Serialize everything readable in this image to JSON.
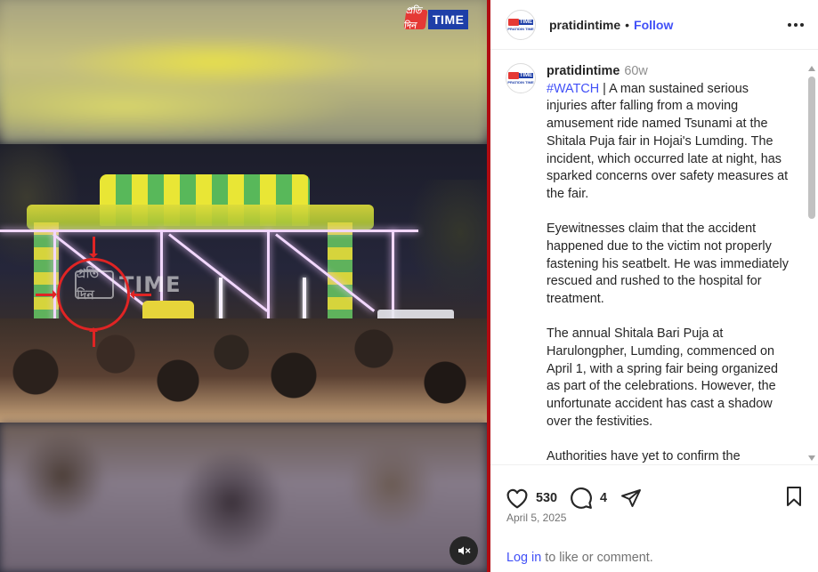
{
  "media": {
    "brand_badge": "প্রতি দিন",
    "brand_time": "TIME",
    "watermark_badge": "প্রতি দিন",
    "watermark_text": "TIME",
    "mute_icon": "speaker-muted-icon"
  },
  "header": {
    "username": "pratidintime",
    "separator": "•",
    "follow_label": "Follow",
    "avatar_label": "PRATIDIN TIME",
    "avatar_mark": "TIME"
  },
  "caption": {
    "username": "pratidintime",
    "time_ago": "60w",
    "hashtag": "#WATCH",
    "paragraphs": [
      " | A man sustained serious injuries after falling from a moving amusement ride named Tsunami at the Shitala Puja fair in Hojai's Lumding. The incident, which occurred late at night, has sparked concerns over safety measures at the fair.",
      "Eyewitnesses claim that the accident happened due to the victim not properly fastening his seatbelt. He was immediately rescued and rushed to the hospital for treatment.",
      "The annual Shitala Bari Puja at Harulongpher, Lumding, commenced on April 1, with a spring fair being organized as part of the celebrations. However, the unfortunate accident has cast a shadow over the festivities.",
      "Authorities have yet to confirm the"
    ]
  },
  "actions": {
    "likes": "530",
    "comments": "4",
    "date": "April 5, 2025",
    "login_link": "Log in",
    "login_rest": " to like or comment."
  },
  "colors": {
    "accent": "#4150f7",
    "divider": "#b00b12",
    "brand_red": "#e53935",
    "brand_blue": "#1e3fa8"
  }
}
